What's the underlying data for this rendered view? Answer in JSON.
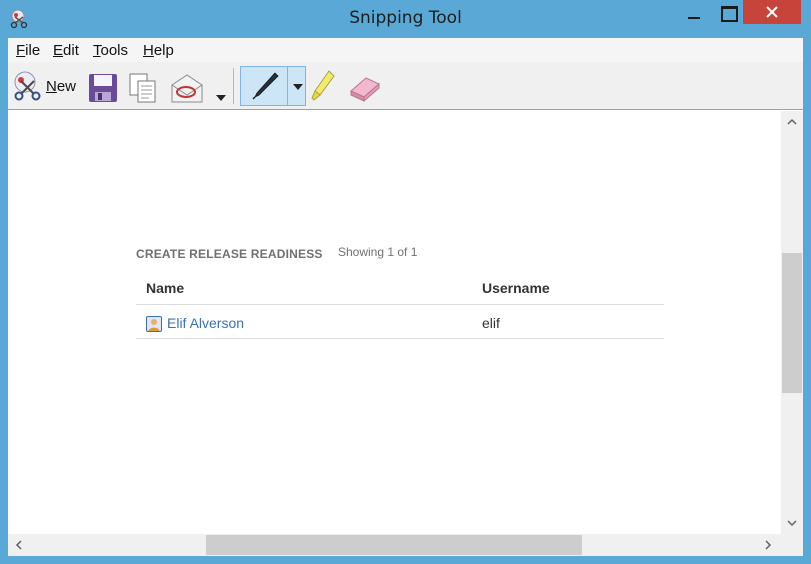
{
  "window": {
    "title": "Snipping Tool"
  },
  "menu": {
    "file": {
      "key": "F",
      "rest": "ile"
    },
    "edit": {
      "key": "E",
      "rest": "dit"
    },
    "tools": {
      "key": "T",
      "rest": "ools"
    },
    "help": {
      "key": "H",
      "rest": "elp"
    }
  },
  "toolbar": {
    "new_key": "N",
    "new_rest": "ew",
    "icons": [
      "scissors-icon",
      "save-icon",
      "copy-icon",
      "send-email-icon",
      "dropdown-arrow-icon",
      "pen-icon",
      "highlighter-icon",
      "eraser-icon"
    ],
    "pen_selected": true
  },
  "content": {
    "section_title": "CREATE RELEASE READINESS",
    "section_count": "Showing 1 of 1",
    "table": {
      "headers": [
        "Name",
        "Username"
      ],
      "rows": [
        {
          "name": "Elif Alverson",
          "username": "elif"
        }
      ]
    }
  },
  "colors": {
    "frame": "#5aa8d6",
    "close_button": "#c7443a",
    "link": "#3b73af",
    "selected_tool": "#cde6f7"
  }
}
